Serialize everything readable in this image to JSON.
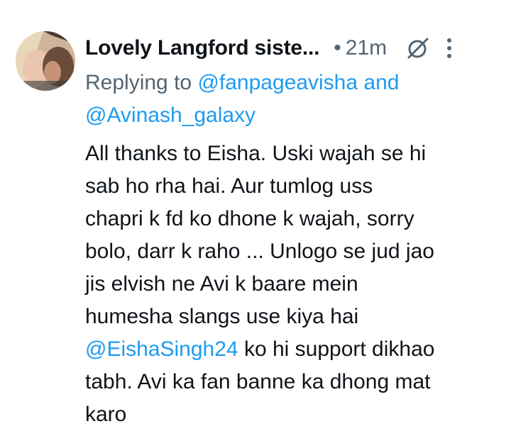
{
  "tweet": {
    "author_name": "Lovely Langford siste...",
    "separator": "•",
    "time": "21m",
    "reply_prefix": "Replying to",
    "reply_mention_1": "@fanpageavisha",
    "reply_and": "and",
    "reply_mention_2": "@Avinash_galaxy",
    "lines": [
      "All thanks to Eisha. Uski wajah se hi",
      "sab ho rha hai. Aur tumlog uss",
      "chapri k fd ko dhone k wajah, sorry",
      "bolo, darr k raho ... Unlogo se jud jao",
      "jis elvish ne Avi k baare mein",
      "humesha slangs use kiya hai"
    ],
    "body_mention": "@EishaSingh24",
    "line_after_mention": " ko hi support dikhao",
    "lines_end": [
      "tabh. Avi ka fan banne ka dhong mat",
      "karo"
    ]
  },
  "icons": {
    "avatar": "profile-avatar",
    "grok": "grok-icon",
    "more": "more-options-icon"
  },
  "colors": {
    "link": "#1d9bf0",
    "secondary": "#536471",
    "text": "#0f1419"
  }
}
